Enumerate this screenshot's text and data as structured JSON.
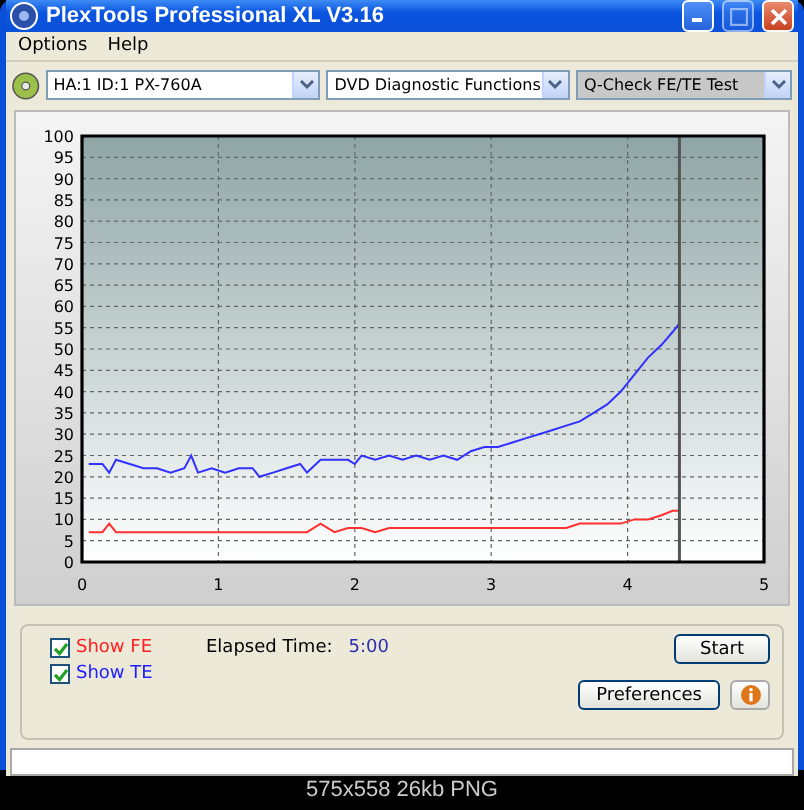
{
  "window": {
    "title": "PlexTools Professional XL V3.16"
  },
  "menu": [
    {
      "label": "Options"
    },
    {
      "label": "Help"
    }
  ],
  "toolbar": [
    {
      "value": "HA:1 ID:1  PX-760A",
      "disabled": false
    },
    {
      "value": "DVD Diagnostic Functions",
      "disabled": false
    },
    {
      "value": "Q-Check FE/TE Test",
      "disabled": true
    }
  ],
  "chart": {
    "chart_data": {
      "type": "line",
      "x": [
        0.05,
        0.15,
        0.2,
        0.25,
        0.35,
        0.45,
        0.55,
        0.65,
        0.75,
        0.8,
        0.85,
        0.95,
        1.05,
        1.15,
        1.25,
        1.3,
        1.4,
        1.5,
        1.6,
        1.65,
        1.75,
        1.85,
        1.95,
        2.0,
        2.05,
        2.15,
        2.25,
        2.35,
        2.45,
        2.55,
        2.65,
        2.75,
        2.85,
        2.95,
        3.05,
        3.15,
        3.25,
        3.35,
        3.45,
        3.55,
        3.65,
        3.75,
        3.85,
        3.95,
        4.05,
        4.15,
        4.25,
        4.33,
        4.38
      ],
      "series": [
        {
          "color": "#3030ff",
          "values": [
            23,
            23,
            21,
            24,
            23,
            22,
            22,
            21,
            22,
            25,
            21,
            22,
            21,
            22,
            22,
            20,
            21,
            22,
            23,
            21,
            24,
            24,
            24,
            23,
            25,
            24,
            25,
            24,
            25,
            24,
            25,
            24,
            26,
            27,
            27,
            28,
            29,
            30,
            31,
            32,
            33,
            35,
            37,
            40,
            44,
            48,
            51,
            54,
            56
          ]
        },
        {
          "color": "#ff3030",
          "values": [
            7,
            7,
            9,
            7,
            7,
            7,
            7,
            7,
            7,
            7,
            7,
            7,
            7,
            7,
            7,
            7,
            7,
            7,
            7,
            7,
            9,
            7,
            8,
            8,
            8,
            7,
            8,
            8,
            8,
            8,
            8,
            8,
            8,
            8,
            8,
            8,
            8,
            8,
            8,
            8,
            9,
            9,
            9,
            9,
            10,
            10,
            11,
            12,
            12
          ]
        }
      ],
      "xlim": [
        0,
        5
      ],
      "ylim": [
        0,
        100
      ],
      "xticks": [
        0,
        1,
        2,
        3,
        4,
        5
      ],
      "yticks": [
        0,
        5,
        10,
        15,
        20,
        25,
        30,
        35,
        40,
        45,
        50,
        55,
        60,
        65,
        70,
        75,
        80,
        85,
        90,
        95,
        100
      ],
      "grid": true,
      "ref_lines": [
        {
          "axis": "x",
          "value": 4.38
        }
      ]
    }
  },
  "options": [
    {
      "label": "Show FE",
      "checked": true,
      "color": "#ff2020"
    },
    {
      "label": "Show TE",
      "checked": true,
      "color": "#2020ff"
    }
  ],
  "elapsed": {
    "label": "Elapsed Time:",
    "value": "5:00"
  },
  "buttons": {
    "start": "Start",
    "preferences": "Preferences"
  },
  "image_caption": "575x558 26kb PNG"
}
